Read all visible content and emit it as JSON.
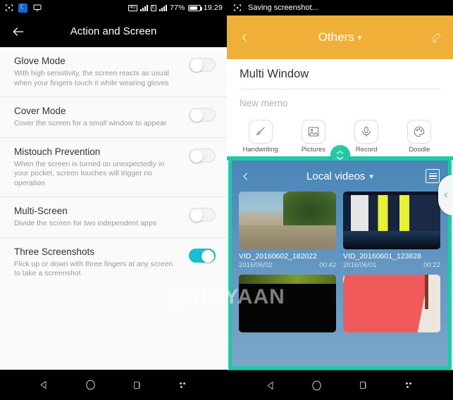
{
  "left_phone": {
    "status_bar": {
      "icons": [
        "screenshot-icon",
        "do-not-disturb-moon-icon",
        "cast-screen-icon"
      ],
      "network_label_1": "4G",
      "network_label_2": "E",
      "battery_percent": "77%",
      "time": "19:29"
    },
    "appbar": {
      "title": "Action and Screen",
      "back_icon": "back-arrow-icon"
    },
    "settings": [
      {
        "title": "Glove Mode",
        "description": "With high sensitivity, the screen reacts as usual when your fingers touch it while wearing gloves",
        "enabled": false
      },
      {
        "title": "Cover Mode",
        "description": "Cover the screen for a small window to appear",
        "enabled": false
      },
      {
        "title": "Mistouch Prevention",
        "description": "When the screen is turned on unexpectedly in your pocket, screen touches will trigger no operation",
        "enabled": false
      },
      {
        "title": "Multi-Screen",
        "description": "Divide the screen for two independent apps",
        "enabled": false
      },
      {
        "title": "Three Screenshots",
        "description": "Flick up or down with three fingers at any screen to take a screenshot",
        "enabled": true
      }
    ],
    "nav_bar": {
      "back": "back-triangle-icon",
      "home": "home-circle-icon",
      "recents": "recents-square-icon",
      "more": "more-dots-icon"
    }
  },
  "right_phone": {
    "status_bar": {
      "icon": "screenshot-icon",
      "text": "Saving screenshot..."
    },
    "notes_header": {
      "back_icon": "chevron-left-icon",
      "title": "Others",
      "caret": "chevron-down-icon",
      "edit_icon": "pen-highlighter-icon"
    },
    "memo": {
      "title": "Multi Window",
      "placeholder": "New memo"
    },
    "tools": [
      {
        "label": "Handwriting",
        "icon": "brush-icon"
      },
      {
        "label": "Pictures",
        "icon": "image-icon"
      },
      {
        "label": "Record",
        "icon": "microphone-icon"
      },
      {
        "label": "Doodle",
        "icon": "palette-icon"
      }
    ],
    "divider_handle": {
      "icon": "resize-up-down-handle-icon"
    },
    "video_window": {
      "back_icon": "chevron-left-icon",
      "title": "Local videos",
      "caret": "chevron-down-icon",
      "menu_icon": "list-menu-icon",
      "videos": [
        {
          "name": "VID_20160602_182022",
          "date": "2016/06/02",
          "duration": "00:42",
          "art": "t1"
        },
        {
          "name": "VID_20160601_123828",
          "date": "2016/06/01",
          "duration": "00:22",
          "art": "t2"
        },
        {
          "name": "",
          "date": "",
          "duration": "",
          "art": "t3"
        },
        {
          "name": "",
          "date": "",
          "duration": "",
          "art": "t4"
        }
      ]
    },
    "edge_tab": {
      "icon": "chevron-left-icon"
    },
    "nav_bar": {
      "back": "back-triangle-icon",
      "home": "home-circle-icon",
      "recents": "recents-square-icon",
      "more": "more-dots-icon"
    }
  },
  "watermark": {
    "text": "BIGYAAN"
  },
  "colors": {
    "toggle_on": "#18bfd0",
    "notes_header": "#efaf38",
    "split_accent": "#1fc9a8",
    "video_bg": "#5e93bf"
  }
}
